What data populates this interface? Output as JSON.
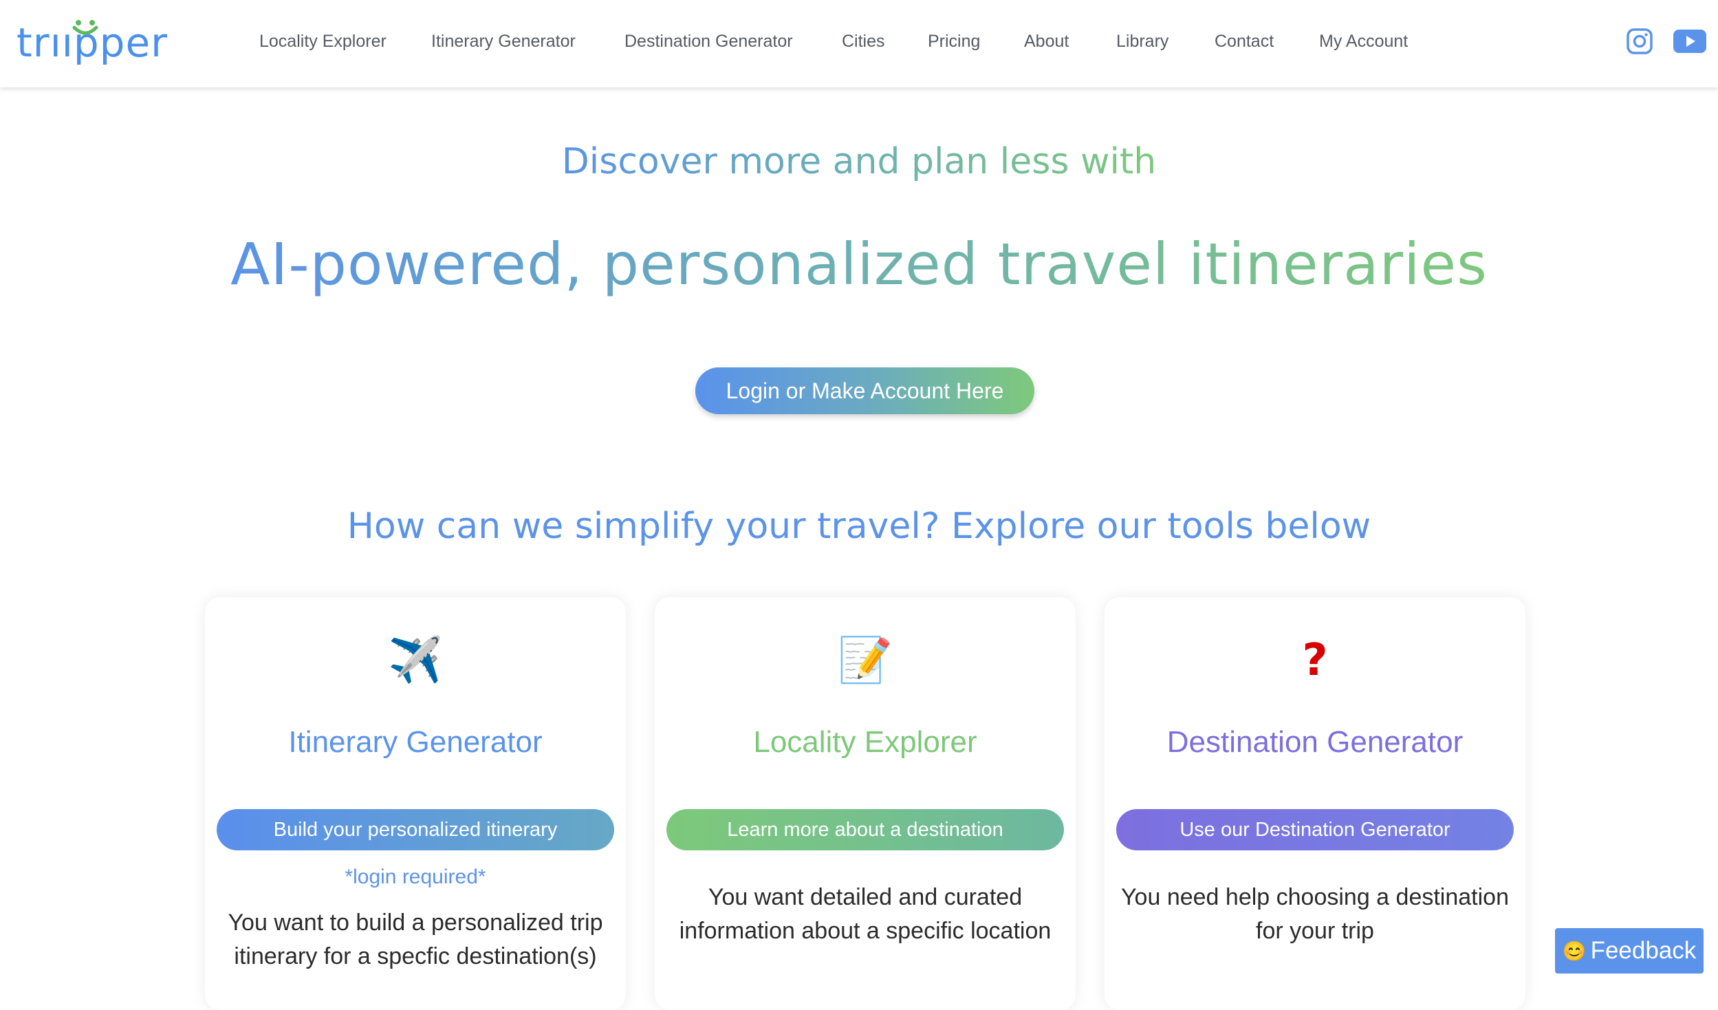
{
  "brand": {
    "logo_text": "triipper",
    "logo_color": "#4a90ee",
    "smile_color": "#5cb85c"
  },
  "nav": {
    "links": [
      "Locality Explorer",
      "Itinerary Generator",
      "Destination Generator",
      "Cities",
      "Pricing",
      "About",
      "Library",
      "Contact",
      "My Account"
    ],
    "social": [
      {
        "name": "instagram-icon",
        "label": "Instagram"
      },
      {
        "name": "youtube-icon",
        "label": "YouTube"
      }
    ]
  },
  "hero": {
    "subtitle": "Discover more and plan less with",
    "title": "AI-powered, personalized travel itineraries",
    "cta_label": "Login or Make Account Here"
  },
  "tools": {
    "heading": "How can we simplify your travel? Explore our tools below",
    "cards": [
      {
        "icon": "✈️",
        "icon_name": "airplane-icon",
        "title": "Itinerary Generator",
        "title_color": "#5b93ea",
        "button_label": "Build your personalized itinerary",
        "button_gradient": [
          "#5a8fec",
          "#66a8c6"
        ],
        "note": "*login required*",
        "description": [
          "You want to build a personalized trip",
          "itinerary for a specfic destination(s)"
        ]
      },
      {
        "icon": "📝",
        "icon_name": "memo-icon",
        "title": "Locality Explorer",
        "title_color": "#7dc87a",
        "button_label": "Learn more about a destination",
        "button_gradient": [
          "#7dc97a",
          "#6db8a0"
        ],
        "note": "",
        "description": [
          "You want detailed and curated",
          "information about a specific location"
        ]
      },
      {
        "icon": "❓",
        "icon_name": "question-mark-icon",
        "title": "Destination Generator",
        "title_color": "#7b6fdf",
        "button_label": "Use our Destination Generator",
        "button_gradient": [
          "#7d6fdf",
          "#7482e4"
        ],
        "note": "",
        "description": [
          "You need help choosing a destination",
          "for your trip"
        ]
      }
    ]
  },
  "feedback": {
    "emoji": "😊",
    "label": "Feedback",
    "color": "#5b93ea"
  }
}
